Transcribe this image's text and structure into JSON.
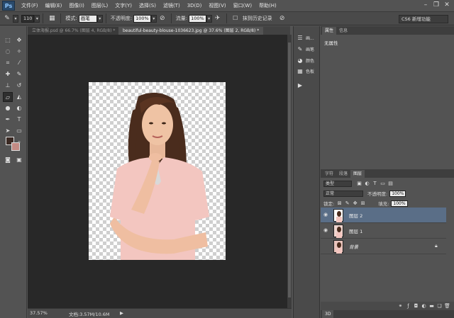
{
  "app": {
    "logo": "Ps"
  },
  "menu": [
    "文件(F)",
    "编辑(E)",
    "图像(I)",
    "图层(L)",
    "文字(Y)",
    "选择(S)",
    "滤镜(T)",
    "3D(D)",
    "视图(V)",
    "窗口(W)",
    "帮助(H)"
  ],
  "window_controls": {
    "minimize": "–",
    "restore": "❐",
    "close": "✕"
  },
  "options": {
    "brush_size": "110",
    "mode_label": "模式:",
    "mode_value": "画笔",
    "opacity_label": "不透明度:",
    "opacity_value": "100%",
    "flow_label": "流量:",
    "flow_value": "100%",
    "history_label": "抹到历史记录",
    "workspace": "CS6 新增功能"
  },
  "tabs": [
    {
      "label": "立体海报.psd @ 66.7% (图层 4, RGB/8) *",
      "active": false
    },
    {
      "label": "beautiful-beauty-blouse-1036623.jpg @ 37.6% (图层 2, RGB/8) *",
      "active": true
    }
  ],
  "status": {
    "zoom": "37.57%",
    "doc_info": "文档:3.57M/10.6M"
  },
  "strip": [
    {
      "icon": "sliders-icon",
      "label": "画..."
    },
    {
      "icon": "brush-icon",
      "label": "画笔"
    },
    {
      "icon": "palette-icon",
      "label": "颜色"
    },
    {
      "icon": "swatches-icon",
      "label": "色板"
    },
    {
      "icon": "play-icon",
      "label": ""
    }
  ],
  "properties": {
    "tabs": [
      "属性",
      "信息"
    ],
    "body": "无属性"
  },
  "layers_panel": {
    "tabs": [
      "字符",
      "段落",
      "图层"
    ],
    "filter": "类型",
    "blend_mode": "正常",
    "opacity_label": "不透明度:",
    "opacity_value": "100%",
    "lock_label": "锁定:",
    "fill_label": "填充:",
    "fill_value": "100%",
    "layers": [
      {
        "name": "图层 2",
        "visible": true,
        "selected": true
      },
      {
        "name": "图层 1",
        "visible": true,
        "selected": false
      },
      {
        "name": "背景",
        "visible": false,
        "selected": false,
        "locked": true
      }
    ]
  },
  "bottom_tab": "3D",
  "colors": {
    "foreground": "#3b2a24",
    "background": "#c48b84",
    "selection": "#5a6e87"
  }
}
